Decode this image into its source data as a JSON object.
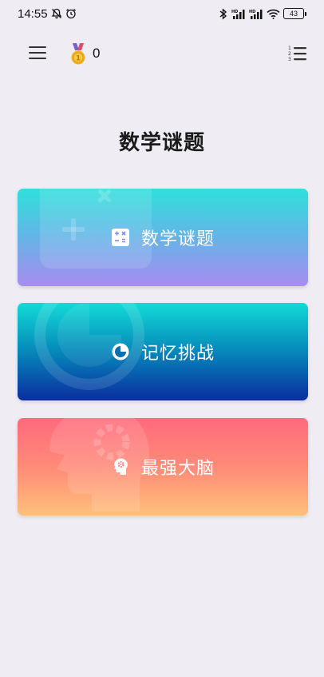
{
  "status_bar": {
    "time": "14:55",
    "battery": "43"
  },
  "app_bar": {
    "menu_icon": "hamburger-menu-icon",
    "medal_icon": "medal-icon",
    "score": "0",
    "list_icon": "numbered-list-icon"
  },
  "page": {
    "title": "数学谜题"
  },
  "cards": [
    {
      "label": "数学谜题",
      "icon": "calculator-icon",
      "colors": [
        "#2fe0dc",
        "#a88cf0"
      ]
    },
    {
      "label": "记忆挑战",
      "icon": "timer-icon",
      "colors": [
        "#12dbd6",
        "#0a2ea0"
      ]
    },
    {
      "label": "最强大脑",
      "icon": "brain-gear-icon",
      "colors": [
        "#ff6a7d",
        "#ffc07a"
      ]
    }
  ]
}
